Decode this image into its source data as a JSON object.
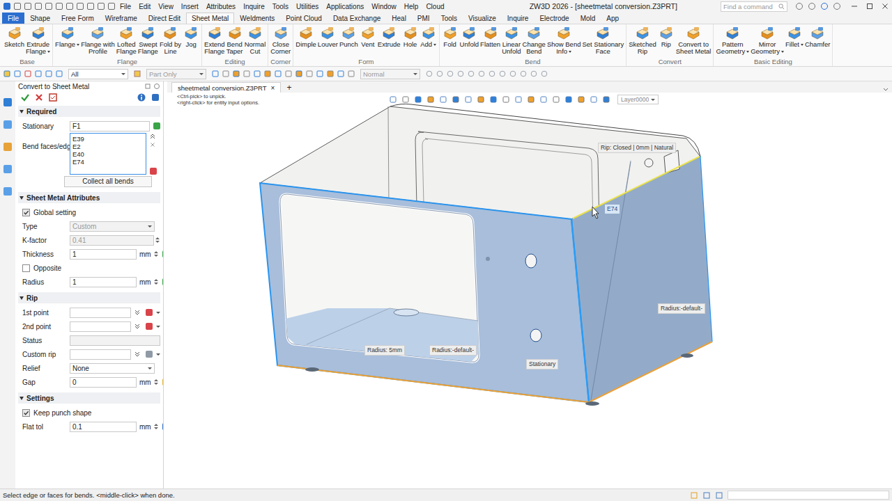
{
  "title_bar": {
    "menus": [
      "File",
      "Edit",
      "View",
      "Insert",
      "Attributes",
      "Inquire",
      "Tools",
      "Utilities",
      "Applications",
      "Window",
      "Help",
      "Cloud"
    ],
    "title": "ZW3D 2026 - [sheetmetal conversion.Z3PRT]",
    "search": {
      "placeholder": "Find a command"
    }
  },
  "ribbon_tabs": [
    {
      "label": "File",
      "kind": "file",
      "selected": false
    },
    {
      "label": "Shape",
      "kind": "tab",
      "selected": false
    },
    {
      "label": "Free Form",
      "kind": "tab",
      "selected": false
    },
    {
      "label": "Wireframe",
      "kind": "tab",
      "selected": false
    },
    {
      "label": "Direct Edit",
      "kind": "tab",
      "selected": false
    },
    {
      "label": "Sheet Metal",
      "kind": "tab",
      "selected": true
    },
    {
      "label": "Weldments",
      "kind": "tab",
      "selected": false
    },
    {
      "label": "Point Cloud",
      "kind": "tab",
      "selected": false
    },
    {
      "label": "Data Exchange",
      "kind": "tab",
      "selected": false
    },
    {
      "label": "Heal",
      "kind": "tab",
      "selected": false
    },
    {
      "label": "PMI",
      "kind": "tab",
      "selected": false
    },
    {
      "label": "Tools",
      "kind": "tab",
      "selected": false
    },
    {
      "label": "Visualize",
      "kind": "tab",
      "selected": false
    },
    {
      "label": "Inquire",
      "kind": "tab",
      "selected": false
    },
    {
      "label": "Electrode",
      "kind": "tab",
      "selected": false
    },
    {
      "label": "Mold",
      "kind": "tab",
      "selected": false
    },
    {
      "label": "App",
      "kind": "tab",
      "selected": false
    }
  ],
  "ribbon_groups": [
    {
      "label": "Base",
      "items": [
        {
          "lines": [
            "Sketch"
          ],
          "dropdown": false
        },
        {
          "lines": [
            "Extrude",
            "Flange"
          ],
          "dropdown": true
        }
      ]
    },
    {
      "label": "Flange",
      "items": [
        {
          "lines": [
            "Flange"
          ],
          "dropdown": true
        },
        {
          "lines": [
            "Flange with",
            "Profile"
          ],
          "dropdown": false
        },
        {
          "lines": [
            "Lofted",
            "Flange"
          ],
          "dropdown": false
        },
        {
          "lines": [
            "Swept",
            "Flange"
          ],
          "dropdown": false
        },
        {
          "lines": [
            "Fold by",
            "Line"
          ],
          "dropdown": false
        },
        {
          "lines": [
            "Jog"
          ],
          "dropdown": false
        }
      ]
    },
    {
      "label": "Editing",
      "items": [
        {
          "lines": [
            "Extend",
            "Flange"
          ],
          "dropdown": false
        },
        {
          "lines": [
            "Bend",
            "Taper"
          ],
          "dropdown": false
        },
        {
          "lines": [
            "Normal",
            "Cut"
          ],
          "dropdown": false
        }
      ]
    },
    {
      "label": "Corner",
      "items": [
        {
          "lines": [
            "Close",
            "Corner"
          ],
          "dropdown": false
        }
      ]
    },
    {
      "label": "Form",
      "items": [
        {
          "lines": [
            "Dimple"
          ],
          "dropdown": false
        },
        {
          "lines": [
            "Louver"
          ],
          "dropdown": false
        },
        {
          "lines": [
            "Punch"
          ],
          "dropdown": false
        },
        {
          "lines": [
            "Vent"
          ],
          "dropdown": false
        },
        {
          "lines": [
            "Extrude"
          ],
          "dropdown": false
        },
        {
          "lines": [
            "Hole"
          ],
          "dropdown": false
        },
        {
          "lines": [
            "Add"
          ],
          "dropdown": true
        }
      ]
    },
    {
      "label": "Bend",
      "items": [
        {
          "lines": [
            "Fold"
          ],
          "dropdown": false
        },
        {
          "lines": [
            "Unfold"
          ],
          "dropdown": false
        },
        {
          "lines": [
            "Flatten"
          ],
          "dropdown": false
        },
        {
          "lines": [
            "Linear",
            "Unfold"
          ],
          "dropdown": false
        },
        {
          "lines": [
            "Change",
            "Bend"
          ],
          "dropdown": false
        },
        {
          "lines": [
            "Show Bend",
            "Info"
          ],
          "dropdown": true
        },
        {
          "lines": [
            "Set Stationary",
            "Face"
          ],
          "dropdown": false
        }
      ]
    },
    {
      "label": "Convert",
      "items": [
        {
          "lines": [
            "Sketched",
            "Rip"
          ],
          "dropdown": false
        },
        {
          "lines": [
            "Rip"
          ],
          "dropdown": false
        },
        {
          "lines": [
            "Convert to",
            "Sheet Metal"
          ],
          "dropdown": false
        }
      ]
    },
    {
      "label": "Basic Editing",
      "items": [
        {
          "lines": [
            "Pattern",
            "Geometry"
          ],
          "dropdown": true
        },
        {
          "lines": [
            "Mirror",
            "Geometry"
          ],
          "dropdown": true
        },
        {
          "lines": [
            "Fillet"
          ],
          "dropdown": true
        },
        {
          "lines": [
            "Chamfer"
          ],
          "dropdown": false
        }
      ]
    }
  ],
  "toolbar": {
    "filter": {
      "value": "All",
      "disabled": false
    },
    "scope": {
      "value": "Part Only",
      "disabled": true
    },
    "mode": {
      "value": "Normal",
      "disabled": true
    }
  },
  "panel": {
    "title": "Convert to Sheet Metal",
    "sections": [
      {
        "title": "Required",
        "expanded": true,
        "rows": [
          {
            "kind": "field",
            "label": "Stationary",
            "value": "F1",
            "unit": "",
            "disabled": false,
            "spin": false,
            "chevron": false,
            "icon_color": "#3aa548",
            "menu": false
          },
          {
            "kind": "list",
            "label": "Bend faces/edges",
            "items": [
              "E39",
              "E2",
              "E40",
              "E74"
            ],
            "focused": true
          },
          {
            "kind": "button",
            "label": "Collect all bends"
          }
        ]
      },
      {
        "title": "Sheet Metal Attributes",
        "expanded": true,
        "rows": [
          {
            "kind": "check",
            "label": "Global setting",
            "checked": true
          },
          {
            "kind": "select",
            "label": "Type",
            "value": "Custom",
            "disabled": true
          },
          {
            "kind": "field",
            "label": "K-factor",
            "value": "0.41",
            "unit": "",
            "disabled": true,
            "spin": true,
            "chevron": false,
            "icon_color": "",
            "menu": false
          },
          {
            "kind": "field",
            "label": "Thickness",
            "value": "1",
            "unit": "mm",
            "disabled": false,
            "spin": true,
            "chevron": false,
            "icon_color": "#3aa548",
            "menu": true
          },
          {
            "kind": "check",
            "label": "Opposite",
            "checked": false
          },
          {
            "kind": "field",
            "label": "Radius",
            "value": "1",
            "unit": "mm",
            "disabled": false,
            "spin": true,
            "chevron": false,
            "icon_color": "#3aa548",
            "menu": true
          }
        ]
      },
      {
        "title": "Rip",
        "expanded": true,
        "rows": [
          {
            "kind": "field",
            "label": "1st point",
            "value": "",
            "unit": "",
            "disabled": false,
            "spin": false,
            "chevron": true,
            "icon_color": "#d9434a",
            "menu": true
          },
          {
            "kind": "field",
            "label": "2nd point",
            "value": "",
            "unit": "",
            "disabled": false,
            "spin": false,
            "chevron": true,
            "icon_color": "#d9434a",
            "menu": true
          },
          {
            "kind": "field",
            "label": "Status",
            "value": "",
            "unit": "",
            "disabled": true,
            "spin": false,
            "chevron": false,
            "icon_color": "",
            "menu": false
          },
          {
            "kind": "field",
            "label": "Custom rip",
            "value": "",
            "unit": "",
            "disabled": false,
            "spin": false,
            "chevron": true,
            "icon_color": "#8f9aa6",
            "menu": true
          },
          {
            "kind": "select",
            "label": "Relief",
            "value": "None",
            "disabled": false
          },
          {
            "kind": "field",
            "label": "Gap",
            "value": "0",
            "unit": "mm",
            "disabled": false,
            "spin": true,
            "chevron": false,
            "icon_color": "#e3b43c",
            "menu": true
          }
        ]
      },
      {
        "title": "Settings",
        "expanded": true,
        "rows": [
          {
            "kind": "check",
            "label": "Keep punch shape",
            "checked": true
          },
          {
            "kind": "field",
            "label": "Flat tol",
            "value": "0.1",
            "unit": "mm",
            "disabled": false,
            "spin": true,
            "chevron": false,
            "icon_color": "#2f6fc0",
            "menu": true
          }
        ]
      }
    ]
  },
  "document_tabs": [
    {
      "label": "sheetmetal conversion.Z3PRT",
      "close": "×",
      "selected": true
    }
  ],
  "new_tab": "+",
  "viewport": {
    "hints": [
      "<Ctrl-pick> to unpick.",
      "<right-click> for entity input options."
    ],
    "layer": "Layer0000",
    "annotations": [
      {
        "text": "Rip: Closed | 0mm | Natural",
        "kind": "tag"
      },
      {
        "text": "E74",
        "kind": "id"
      },
      {
        "text": "Radius:-default-",
        "kind": "tag"
      },
      {
        "text": "Radius: 5mm",
        "kind": "tag"
      },
      {
        "text": "Radius:-default-",
        "kind": "tag"
      },
      {
        "text": "Stationary",
        "kind": "tag"
      }
    ]
  },
  "status_bar": {
    "message": "Select edge or faces for bends. <middle-click> when done."
  }
}
